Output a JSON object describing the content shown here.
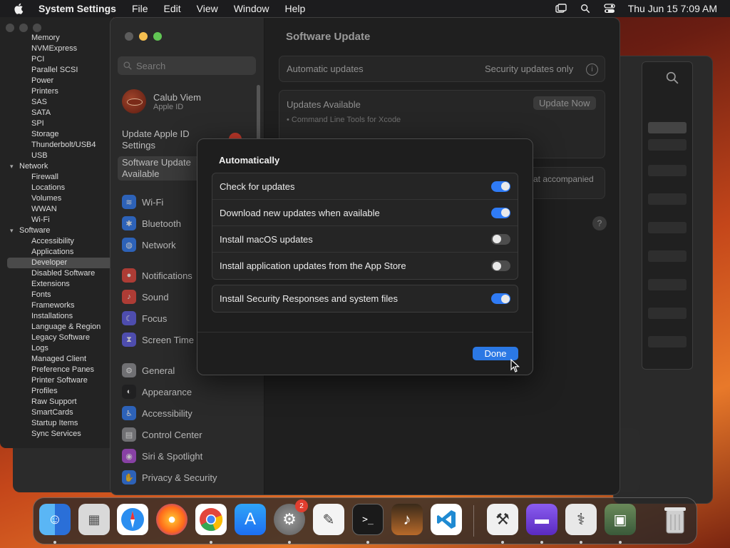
{
  "menubar": {
    "app_name": "System Settings",
    "menus": [
      "File",
      "Edit",
      "View",
      "Window",
      "Help"
    ],
    "datetime": "Thu Jun 15  7:09 AM"
  },
  "sysinfo_tree": [
    {
      "label": "Memory",
      "level": 2
    },
    {
      "label": "NVMExpress",
      "level": 2
    },
    {
      "label": "PCI",
      "level": 2
    },
    {
      "label": "Parallel SCSI",
      "level": 2
    },
    {
      "label": "Power",
      "level": 2
    },
    {
      "label": "Printers",
      "level": 2
    },
    {
      "label": "SAS",
      "level": 2
    },
    {
      "label": "SATA",
      "level": 2
    },
    {
      "label": "SPI",
      "level": 2
    },
    {
      "label": "Storage",
      "level": 2
    },
    {
      "label": "Thunderbolt/USB4",
      "level": 2
    },
    {
      "label": "USB",
      "level": 2
    },
    {
      "label": "Network",
      "level": 1
    },
    {
      "label": "Firewall",
      "level": 2
    },
    {
      "label": "Locations",
      "level": 2
    },
    {
      "label": "Volumes",
      "level": 2
    },
    {
      "label": "WWAN",
      "level": 2
    },
    {
      "label": "Wi-Fi",
      "level": 2
    },
    {
      "label": "Software",
      "level": 1
    },
    {
      "label": "Accessibility",
      "level": 2
    },
    {
      "label": "Applications",
      "level": 2
    },
    {
      "label": "Developer",
      "level": 2,
      "selected": true
    },
    {
      "label": "Disabled Software",
      "level": 2
    },
    {
      "label": "Extensions",
      "level": 2
    },
    {
      "label": "Fonts",
      "level": 2
    },
    {
      "label": "Frameworks",
      "level": 2
    },
    {
      "label": "Installations",
      "level": 2
    },
    {
      "label": "Language & Region",
      "level": 2
    },
    {
      "label": "Legacy Software",
      "level": 2
    },
    {
      "label": "Logs",
      "level": 2
    },
    {
      "label": "Managed Client",
      "level": 2
    },
    {
      "label": "Preference Panes",
      "level": 2
    },
    {
      "label": "Printer Software",
      "level": 2
    },
    {
      "label": "Profiles",
      "level": 2
    },
    {
      "label": "Raw Support",
      "level": 2
    },
    {
      "label": "SmartCards",
      "level": 2
    },
    {
      "label": "Startup Items",
      "level": 2
    },
    {
      "label": "Sync Services",
      "level": 2
    }
  ],
  "sidebar": {
    "search_placeholder": "Search",
    "profile_name": "Calub Viem",
    "profile_sub": "Apple ID",
    "update_apple_id": "Update Apple ID Settings",
    "software_update_avail": "Software Update Available",
    "items": [
      {
        "label": "Wi-Fi",
        "icon": "wifi-icon",
        "color": "#2f7bf5"
      },
      {
        "label": "Bluetooth",
        "icon": "bluetooth-icon",
        "color": "#2f7bf5"
      },
      {
        "label": "Network",
        "icon": "globe-icon",
        "color": "#2f7bf5"
      },
      {
        "label": "Notifications",
        "icon": "bell-icon",
        "color": "#e5453a"
      },
      {
        "label": "Sound",
        "icon": "speaker-icon",
        "color": "#e5453a"
      },
      {
        "label": "Focus",
        "icon": "moon-icon",
        "color": "#5e5ce6"
      },
      {
        "label": "Screen Time",
        "icon": "hourglass-icon",
        "color": "#5e5ce6"
      },
      {
        "label": "General",
        "icon": "gear-icon",
        "color": "#8e8e93"
      },
      {
        "label": "Appearance",
        "icon": "appearance-icon",
        "color": "#1c1c1e"
      },
      {
        "label": "Accessibility",
        "icon": "accessibility-icon",
        "color": "#2f7bf5"
      },
      {
        "label": "Control Center",
        "icon": "control-center-icon",
        "color": "#8e8e93"
      },
      {
        "label": "Siri & Spotlight",
        "icon": "siri-icon",
        "color": "#b04bd8"
      },
      {
        "label": "Privacy & Security",
        "icon": "hand-icon",
        "color": "#2f7bf5"
      }
    ]
  },
  "content": {
    "title": "Software Update",
    "auto_updates_label": "Automatic updates",
    "auto_updates_value": "Security updates only",
    "updates_available": "Updates Available",
    "update_now": "Update Now",
    "update_item": "• Command Line Tools for Xcode",
    "partial_text": "at accompanied"
  },
  "modal": {
    "title": "Automatically",
    "options": [
      {
        "label": "Check for updates",
        "on": true
      },
      {
        "label": "Download new updates when available",
        "on": true
      },
      {
        "label": "Install macOS updates",
        "on": false
      },
      {
        "label": "Install application updates from the App Store",
        "on": false
      }
    ],
    "security_option": {
      "label": "Install Security Responses and system files",
      "on": true
    },
    "done": "Done"
  },
  "dock": {
    "badge_settings": "2",
    "apps": [
      "finder-icon",
      "launchpad-icon",
      "safari-icon",
      "firefox-icon",
      "chrome-icon",
      "app-store-icon",
      "system-settings-icon",
      "textedit-icon",
      "terminal-icon",
      "garageband-icon",
      "vscode-icon",
      "system-information-icon",
      "podman-icon",
      "disk-utility-icon",
      "chip-icon",
      "trash-icon"
    ]
  }
}
